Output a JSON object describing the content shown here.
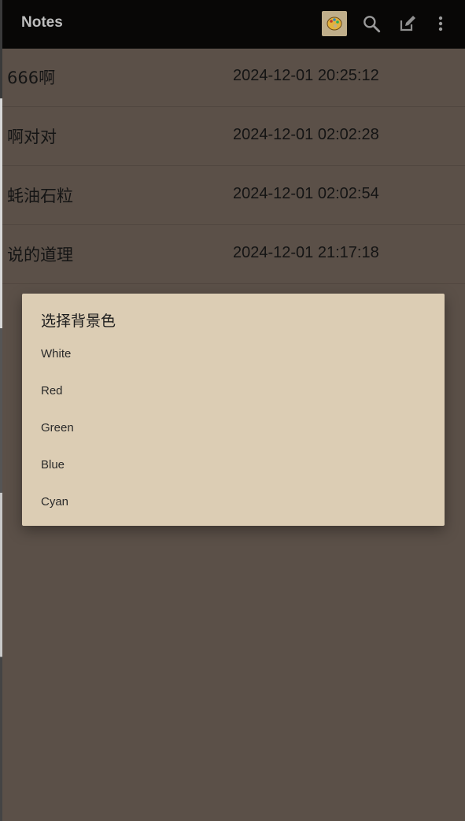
{
  "toolbar": {
    "title": "Notes",
    "actions": [
      {
        "name": "palette-icon"
      },
      {
        "name": "search-icon"
      },
      {
        "name": "edit-icon"
      },
      {
        "name": "overflow-menu-icon"
      }
    ]
  },
  "notes": [
    {
      "title": "666啊",
      "time": "2024-12-01 20:25:12"
    },
    {
      "title": "啊对对",
      "time": "2024-12-01 02:02:28"
    },
    {
      "title": "蚝油石粒",
      "time": "2024-12-01 02:02:54"
    },
    {
      "title": "说的道理",
      "time": "2024-12-01 21:17:18"
    }
  ],
  "dialog": {
    "title": "选择背景色",
    "options": [
      "White",
      "Red",
      "Green",
      "Blue",
      "Cyan"
    ]
  },
  "colors": {
    "toolbar": "#080706",
    "list_background": "#5b5048",
    "dialog_background": "#dccdb4"
  }
}
